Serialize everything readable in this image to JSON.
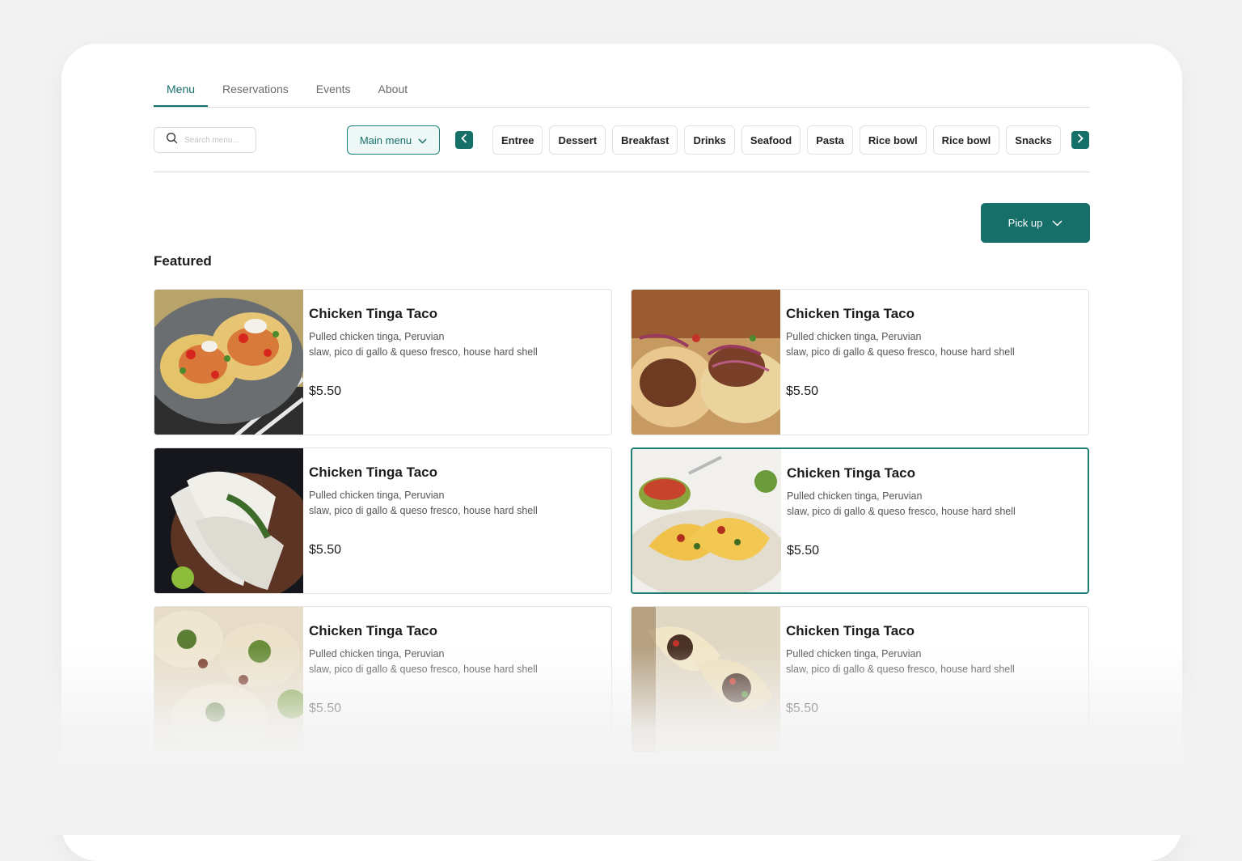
{
  "nav": {
    "tabs": [
      {
        "label": "Menu",
        "active": true
      },
      {
        "label": "Reservations",
        "active": false
      },
      {
        "label": "Events",
        "active": false
      },
      {
        "label": "About",
        "active": false
      }
    ]
  },
  "filters": {
    "search_placeholder": "Search menu...",
    "menu_select": "Main menu",
    "categories": [
      "Entree",
      "Dessert",
      "Breakfast",
      "Drinks",
      "Seafood",
      "Pasta",
      "Rice bowl",
      "Rice bowl",
      "Snacks"
    ]
  },
  "order_type": "Pick up",
  "section_title": "Featured",
  "items": [
    {
      "title": "Chicken Tinga Taco",
      "desc_line1": "Pulled chicken tinga, Peruvian",
      "desc_line2": "slaw, pico di gallo & queso fresco, house hard shell",
      "price": "$5.50",
      "selected": false
    },
    {
      "title": "Chicken Tinga Taco",
      "desc_line1": "Pulled chicken tinga, Peruvian",
      "desc_line2": "slaw, pico di gallo & queso fresco, house hard shell",
      "price": "$5.50",
      "selected": false
    },
    {
      "title": "Chicken Tinga Taco",
      "desc_line1": "Pulled chicken tinga, Peruvian",
      "desc_line2": "slaw, pico di gallo & queso fresco, house hard shell",
      "price": "$5.50",
      "selected": false
    },
    {
      "title": "Chicken Tinga Taco",
      "desc_line1": "Pulled chicken tinga, Peruvian",
      "desc_line2": "slaw, pico di gallo & queso fresco, house hard shell",
      "price": "$5.50",
      "selected": true
    },
    {
      "title": "Chicken Tinga Taco",
      "desc_line1": "Pulled chicken tinga, Peruvian",
      "desc_line2": "slaw, pico di gallo & queso fresco, house hard shell",
      "price": "$5.50",
      "selected": false
    },
    {
      "title": "Chicken Tinga Taco",
      "desc_line1": "Pulled chicken tinga, Peruvian",
      "desc_line2": "slaw, pico di gallo & queso fresco, house hard shell",
      "price": "$5.50",
      "selected": false
    }
  ],
  "colors": {
    "accent": "#176f69",
    "accent_light": "#eef8f7",
    "background": "#f3f3f3"
  },
  "icons": {
    "search": "search-icon",
    "dropdown": "chevron-down-icon",
    "prev": "chevron-left-icon",
    "next": "chevron-right-icon"
  }
}
